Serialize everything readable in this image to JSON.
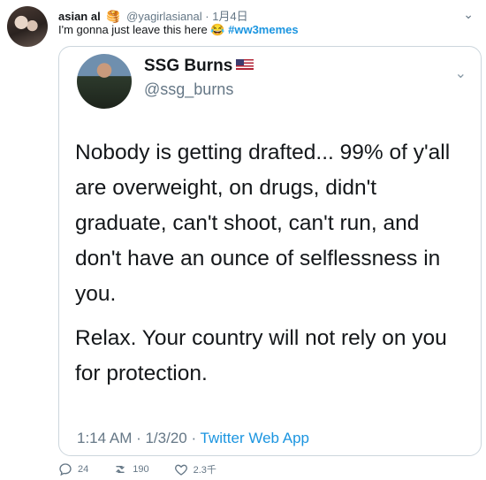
{
  "tweet": {
    "author_name": "asian al",
    "author_emoji": "🥞",
    "handle": "@yagirlasianal",
    "date_sep": "·",
    "date": "1月4日",
    "text": "I'm gonna just leave this here 😂",
    "hashtag": "#ww3memes"
  },
  "quoted": {
    "name": "SSG Burns",
    "handle": "@ssg_burns",
    "paragraph1": "Nobody is getting drafted... 99% of y'all are overweight, on drugs, didn't graduate, can't shoot, can't run, and don't have an ounce of selflessness in you.",
    "paragraph2": "Relax. Your country will not rely on you for protection.",
    "time": "1:14 AM · 1/3/20 · ",
    "source": "Twitter Web App"
  },
  "actions": {
    "replies": "24",
    "retweets": "190",
    "likes": "2.3千"
  },
  "colors": {
    "link": "#1b95e0",
    "secondary_text": "#657786",
    "border": "#ccd6dd"
  }
}
